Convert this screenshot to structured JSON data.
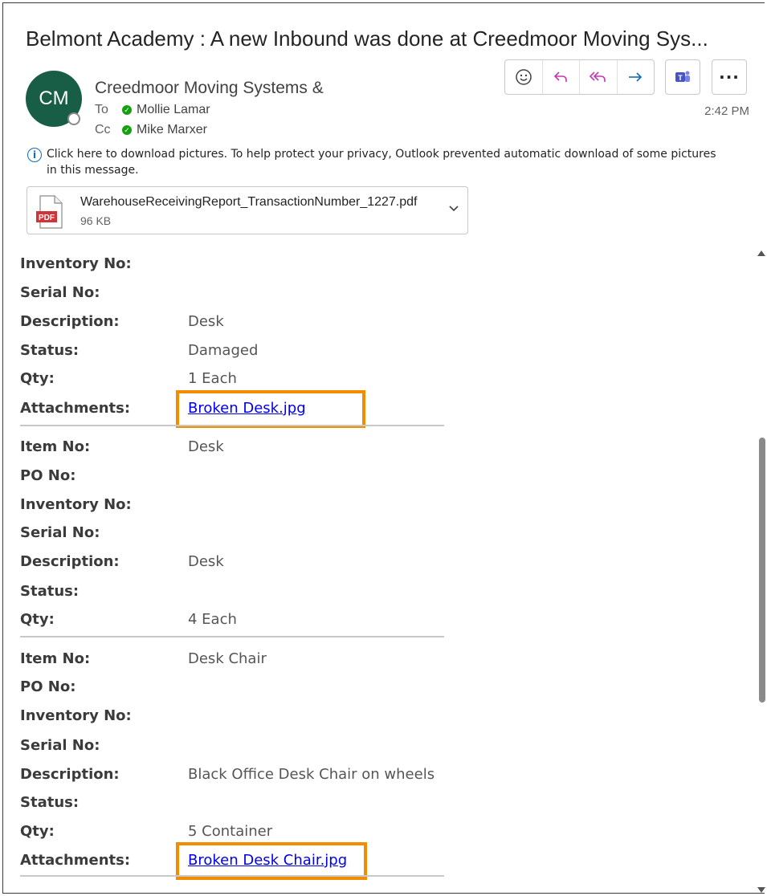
{
  "email": {
    "subject": "Belmont Academy : A new Inbound was done at Creedmoor Moving Sys...",
    "avatar_initials": "CM",
    "sender": "Creedmoor Moving Systems &",
    "to_label": "To",
    "to_name": "Mollie Lamar",
    "cc_label": "Cc",
    "cc_name": "Mike Marxer",
    "time": "2:42 PM",
    "privacy_notice": "Click here to download pictures. To help protect your privacy, Outlook prevented automatic download of some pictures in this message.",
    "attachment": {
      "name": "WarehouseReceivingReport_TransactionNumber_1227.pdf",
      "size": "96 KB",
      "type_label": "PDF"
    }
  },
  "toolbar": {
    "icons": [
      "smiley-icon",
      "reply-icon",
      "reply-all-icon",
      "forward-icon",
      "teams-icon",
      "more-icon"
    ],
    "accent_reply": "#c239b3",
    "accent_forward": "#0f6cbd",
    "accent_teams": "#4b53bc"
  },
  "labels": {
    "inventory_no": "Inventory No:",
    "serial_no": "Serial No:",
    "description": "Description:",
    "status": "Status:",
    "qty": "Qty:",
    "attachments": "Attachments:",
    "item_no": "Item No:",
    "po_no": "PO No:"
  },
  "items": [
    {
      "description": "Desk",
      "status": "Damaged",
      "qty": "1 Each",
      "attachment": "Broken Desk.jpg"
    },
    {
      "item_no": "Desk",
      "description": "Desk",
      "qty": "4 Each"
    },
    {
      "item_no": "Desk Chair",
      "description": "Black Office Desk Chair on wheels",
      "qty": "5 Container",
      "attachment": "Broken Desk Chair.jpg"
    }
  ],
  "highlight_color": "#f28c00"
}
